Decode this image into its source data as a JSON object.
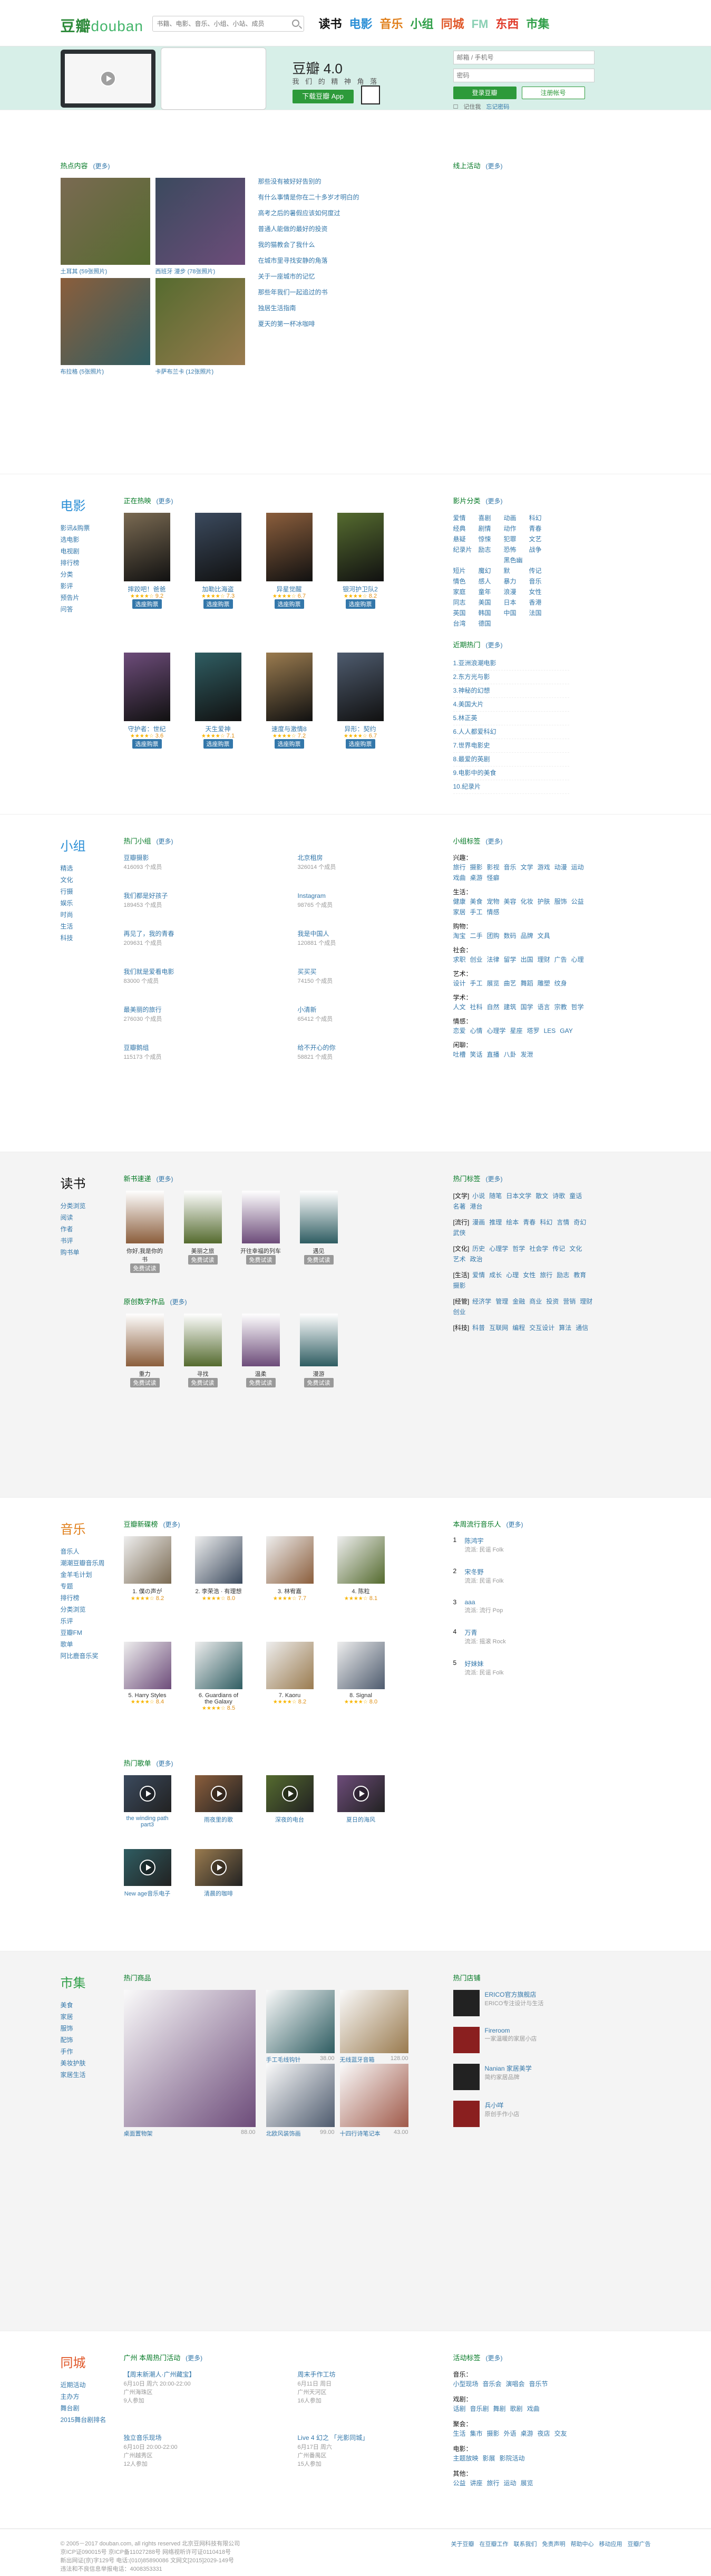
{
  "header": {
    "logo_main": "豆瓣",
    "logo_sub": "douban",
    "search_placeholder": "书籍、电影、音乐、小组、小站、成员",
    "nav": [
      {
        "label": "读书",
        "color": "#111"
      },
      {
        "label": "电影",
        "color": "#2b8fd6"
      },
      {
        "label": "音乐",
        "color": "#e07f1b"
      },
      {
        "label": "小组",
        "color": "#2f9f48"
      },
      {
        "label": "同城",
        "color": "#e05627"
      },
      {
        "label": "FM",
        "color": "#8ad0b4"
      },
      {
        "label": "东西",
        "color": "#e03a2a"
      },
      {
        "label": "市集",
        "color": "#2f9f48"
      }
    ]
  },
  "hero": {
    "app_name": "豆瓣 4.0",
    "app_desc": "我 们 的 精 神 角 落",
    "download": "下载豆瓣 App",
    "login": {
      "email_placeholder": "邮箱 / 手机号",
      "password_placeholder": "密码",
      "login": "登录豆瓣",
      "register": "注册帐号",
      "remember": "记住我",
      "forgot": "忘记密码"
    }
  },
  "hot": {
    "title": "热点内容",
    "more": "(更多)",
    "photos": [
      {
        "caption": "土耳其 (59张照片)"
      },
      {
        "caption": "西班牙 漫步 (78张照片)"
      },
      {
        "caption": "布拉格 (5张照片)"
      },
      {
        "caption": "卡萨布兰卡 (12张照片)"
      }
    ],
    "articles": [
      "那些没有被好好告别的",
      "有什么事情是你在二十多岁才明白的",
      "高考之后的暑假应该如何度过",
      "普通人能做的最好的投资",
      "我的猫教会了我什么",
      "在城市里寻找安静的角落",
      "关于一座城市的记忆",
      "那些年我们一起追过的书",
      "独居生活指南",
      "夏天的第一杯冰咖啡"
    ],
    "online_title": "线上活动",
    "online_more": "(更多)"
  },
  "movie": {
    "side_title": "电影",
    "side_links": [
      "影讯&购票",
      "选电影",
      "电视剧",
      "排行榜",
      "分类",
      "影评",
      "预告片",
      "问答"
    ],
    "title": "正在热映",
    "more": "(更多)",
    "buy": "选座购票",
    "items": [
      {
        "name": "摔跤吧！爸爸",
        "rating": "9.2"
      },
      {
        "name": "加勒比海盗5：...",
        "rating": "7.3"
      },
      {
        "name": "异星觉醒",
        "rating": "6.7"
      },
      {
        "name": "银河护卫队2",
        "rating": "8.2"
      },
      {
        "name": "守护者：世纪战...",
        "rating": "3.6"
      },
      {
        "name": "天生爱神",
        "rating": "7.1"
      },
      {
        "name": "速度与激情8",
        "rating": "7.2"
      },
      {
        "name": "异形：契约",
        "rating": "6.7"
      }
    ],
    "cat_title": "影片分类",
    "cat_more": "(更多)",
    "cats": [
      "爱情",
      "喜剧",
      "动画",
      "科幻",
      "经典",
      "剧情",
      "动作",
      "青春",
      "悬疑",
      "惊悚",
      "犯罪",
      "文艺",
      "纪录片",
      "励志",
      "恐怖",
      "战争",
      "短片",
      "魔幻",
      "黑色幽默",
      "传记",
      "情色",
      "感人",
      "暴力",
      "音乐",
      "家庭",
      "童年",
      "浪漫",
      "女性",
      "同志",
      "美国",
      "日本",
      "香港",
      "英国",
      "韩国",
      "中国",
      "法国",
      "台湾",
      "德国"
    ],
    "rank_title": "近期热门",
    "rank_more": "(更多)",
    "ranks": [
      "1.亚洲浪潮电影",
      "2.东方光与影",
      "3.神秘的幻想",
      "4.美国大片",
      "5.林正英",
      "6.人人都爱科幻",
      "7.世界电影史",
      "8.最爱的英剧",
      "9.电影中的美食",
      "10.纪录片"
    ]
  },
  "group": {
    "side_title": "小组",
    "side_links": [
      "精选",
      "文化",
      "行摄",
      "娱乐",
      "时尚",
      "生活",
      "科技"
    ],
    "title": "热门小组",
    "more": "(更多)",
    "items": [
      {
        "name": "豆瓣摄影",
        "members": "416093 个成员"
      },
      {
        "name": "北京租房",
        "members": "326014 个成员"
      },
      {
        "name": "我们都是好孩子",
        "members": "189453 个成员"
      },
      {
        "name": "Instagram",
        "members": "98765 个成员"
      },
      {
        "name": "再见了，我的青春",
        "members": "209631 个成员"
      },
      {
        "name": "我是中国人",
        "members": "120881 个成员"
      },
      {
        "name": "我们就是爱看电影",
        "members": "83000 个成员"
      },
      {
        "name": "买买买",
        "members": "74150 个成员"
      },
      {
        "name": "最美丽的旅行",
        "members": "276030 个成员"
      },
      {
        "name": "小清新",
        "members": "65412 个成员"
      },
      {
        "name": "豆瓣鹅组",
        "members": "115173 个成员"
      },
      {
        "name": "给不开心的你",
        "members": "58821 个成员"
      }
    ],
    "tag_title": "小组标签",
    "tag_more": "(更多)",
    "tag_groups": [
      {
        "k": "兴趣：",
        "tags": [
          "旅行",
          "摄影",
          "影视",
          "音乐",
          "文学",
          "游戏",
          "动漫",
          "运动",
          "戏曲",
          "桌游",
          "怪癖"
        ]
      },
      {
        "k": "生活：",
        "tags": [
          "健康",
          "美食",
          "宠物",
          "美容",
          "化妆",
          "护肤",
          "服饰",
          "公益",
          "家居",
          "手工",
          "情感"
        ]
      },
      {
        "k": "购物：",
        "tags": [
          "淘宝",
          "二手",
          "团购",
          "数码",
          "品牌",
          "文具"
        ]
      },
      {
        "k": "社会：",
        "tags": [
          "求职",
          "创业",
          "法律",
          "留学",
          "出国",
          "理财",
          "广告",
          "心理"
        ]
      },
      {
        "k": "艺术：",
        "tags": [
          "设计",
          "手工",
          "展览",
          "曲艺",
          "舞蹈",
          "雕塑",
          "纹身"
        ]
      },
      {
        "k": "学术：",
        "tags": [
          "人文",
          "社科",
          "自然",
          "建筑",
          "国学",
          "语言",
          "宗教",
          "哲学"
        ]
      },
      {
        "k": "情感：",
        "tags": [
          "恋爱",
          "心情",
          "心理学",
          "星座",
          "塔罗",
          "LES",
          "GAY"
        ]
      },
      {
        "k": "闲聊：",
        "tags": [
          "吐槽",
          "笑话",
          "直播",
          "八卦",
          "发泄"
        ]
      }
    ]
  },
  "book": {
    "side_title": "读书",
    "side_links": [
      "分类浏览",
      "阅读",
      "作者",
      "书评",
      "购书单"
    ],
    "new_title": "新书速递",
    "new_more": "(更多)",
    "new_books": [
      {
        "name": "你好,我是你的书",
        "price": "免费试读"
      },
      {
        "name": "美丽之旅",
        "price": "免费试读"
      },
      {
        "name": "开往幸福的列车",
        "price": "免费试读"
      },
      {
        "name": "遇见",
        "price": "免费试读"
      }
    ],
    "origin_title": "原创数字作品",
    "origin_more": "(更多)",
    "origin_books": [
      {
        "name": "重力",
        "price": "免费试读"
      },
      {
        "name": "寻找",
        "price": "免费试读"
      },
      {
        "name": "温柔",
        "price": "免费试读"
      },
      {
        "name": "漫游",
        "price": "免费试读"
      }
    ],
    "tag_title": "热门标签",
    "tag_more": "(更多)",
    "tag_groups": [
      {
        "k": "[文学]",
        "tags": [
          "小说",
          "随笔",
          "日本文学",
          "散文",
          "诗歌",
          "童话",
          "名著",
          "港台"
        ]
      },
      {
        "k": "[流行]",
        "tags": [
          "漫画",
          "推理",
          "绘本",
          "青春",
          "科幻",
          "言情",
          "奇幻",
          "武侠"
        ]
      },
      {
        "k": "[文化]",
        "tags": [
          "历史",
          "心理学",
          "哲学",
          "社会学",
          "传记",
          "文化",
          "艺术",
          "政治"
        ]
      },
      {
        "k": "[生活]",
        "tags": [
          "爱情",
          "成长",
          "心理",
          "女性",
          "旅行",
          "励志",
          "教育",
          "摄影"
        ]
      },
      {
        "k": "[经管]",
        "tags": [
          "经济学",
          "管理",
          "金融",
          "商业",
          "投资",
          "营销",
          "理财",
          "创业"
        ]
      },
      {
        "k": "[科技]",
        "tags": [
          "科普",
          "互联网",
          "编程",
          "交互设计",
          "算法",
          "通信"
        ]
      }
    ]
  },
  "music": {
    "side_title": "音乐",
    "side_links": [
      "音乐人",
      "潮潮豆瓣音乐周",
      "金羊毛计划",
      "专题",
      "排行榜",
      "分类浏览",
      "乐评",
      "豆瓣FM",
      "歌单",
      "阿比鹿音乐奖"
    ],
    "new_title": "豆瓣新碟榜",
    "new_more": "(更多)",
    "albums": [
      {
        "name": "1. 僕の声が",
        "rating": "8.2"
      },
      {
        "name": "2. 李荣浩 · 有理想",
        "rating": "8.0"
      },
      {
        "name": "3. 林宥嘉",
        "rating": "7.7"
      },
      {
        "name": "4. 陈粒",
        "rating": "8.1"
      },
      {
        "name": "5. Harry Styles",
        "rating": "8.4"
      },
      {
        "name": "6. Guardians of the Galaxy",
        "rating": "8.5"
      },
      {
        "name": "7. Kaoru",
        "rating": "8.2"
      },
      {
        "name": "8. Signal",
        "rating": "8.0"
      }
    ],
    "songs_title": "热门歌单",
    "songs_more": "(更多)",
    "songs": [
      "the winding path part3",
      "雨夜里的歌",
      "深夜的电台",
      "夏日的海风",
      "New age音乐电子",
      "清晨的咖啡"
    ],
    "artist_title": "本周流行音乐人",
    "artist_more": "(更多)",
    "artists": [
      {
        "name": "陈鸿宇",
        "info": "流派: 民谣 Folk"
      },
      {
        "name": "宋冬野",
        "info": "流派: 民谣 Folk"
      },
      {
        "name": "aaa",
        "info": "流派: 流行 Pop"
      },
      {
        "name": "万青",
        "info": "流派: 摇滚 Rock"
      },
      {
        "name": "好妹妹",
        "info": "流派: 民谣 Folk"
      }
    ]
  },
  "market": {
    "side_title": "市集",
    "side_links": [
      "美食",
      "家居",
      "服饰",
      "配饰",
      "手作",
      "美妆护肤",
      "家居生活"
    ],
    "hot_title": "热门商品",
    "items": [
      {
        "name": "桌面置物架",
        "price": "88.00"
      },
      {
        "name": "手工毛线钩针",
        "price": "38.00"
      },
      {
        "name": "无线蓝牙音箱",
        "price": "128.00"
      },
      {
        "name": "北欧风装饰画",
        "price": "99.00"
      },
      {
        "name": "十四行诗笔记本",
        "price": "43.00"
      }
    ],
    "shop_title": "热门店铺",
    "shops": [
      {
        "name": "ERICO官方旗舰店",
        "desc": "ERICO专注设计与生活"
      },
      {
        "name": "Fireroom",
        "desc": "一家温暖的家居小店"
      },
      {
        "name": "Nanian 家居美学",
        "desc": "简约家居品牌"
      },
      {
        "name": "兵小咩",
        "desc": "原创手作小店"
      }
    ]
  },
  "local": {
    "side_title": "同城",
    "side_links": [
      "近期活动",
      "主办方",
      "舞台剧",
      "2015舞台剧排名"
    ],
    "city": "广州",
    "title": "本周热门活动",
    "more": "(更多)",
    "events": [
      {
        "name": "【周末新潮人·广州藏宝】",
        "time": "6月10日 周六 20:00-22:00",
        "place": "广州海珠区",
        "count": "9人参加"
      },
      {
        "name": "周末手作工坊",
        "time": "6月11日 周日",
        "place": "广州天河区",
        "count": "16人参加"
      },
      {
        "name": "独立音乐现场",
        "time": "6月10日 20:00-22:00",
        "place": "广州越秀区",
        "count": "12人参加"
      },
      {
        "name": "Live 4 幻之 「光影同城」",
        "time": "6月17日 周六",
        "place": "广州番禺区",
        "count": "15人参加"
      }
    ],
    "cat_title": "活动标签",
    "cat_more": "(更多)",
    "cat_groups": [
      {
        "k": "音乐：",
        "tags": [
          "小型现场",
          "音乐会",
          "演唱会",
          "音乐节"
        ]
      },
      {
        "k": "戏剧：",
        "tags": [
          "话剧",
          "音乐剧",
          "舞剧",
          "歌剧",
          "戏曲"
        ]
      },
      {
        "k": "聚会：",
        "tags": [
          "生活",
          "集市",
          "摄影",
          "外语",
          "桌游",
          "夜店",
          "交友"
        ]
      },
      {
        "k": "电影：",
        "tags": [
          "主题放映",
          "影展",
          "影院活动"
        ]
      },
      {
        "k": "其他：",
        "tags": [
          "公益",
          "讲座",
          "旅行",
          "运动",
          "展览"
        ]
      }
    ]
  },
  "footer": {
    "copy": "© 2005－2017 douban.com, all rights reserved 北京豆网科技有限公司",
    "lines": [
      "京ICP证090015号 京ICP备11027288号 网络视听许可证0110418号",
      "新出网证(京)字129号 电话:(010)85890086 文网文[2015]2029-149号",
      "违法和不良信息举报电话：4008353331"
    ],
    "links": [
      "关于豆瓣",
      "在豆瓣工作",
      "联系我们",
      "免责声明",
      "帮助中心",
      "移动应用",
      "豆瓣广告"
    ]
  }
}
